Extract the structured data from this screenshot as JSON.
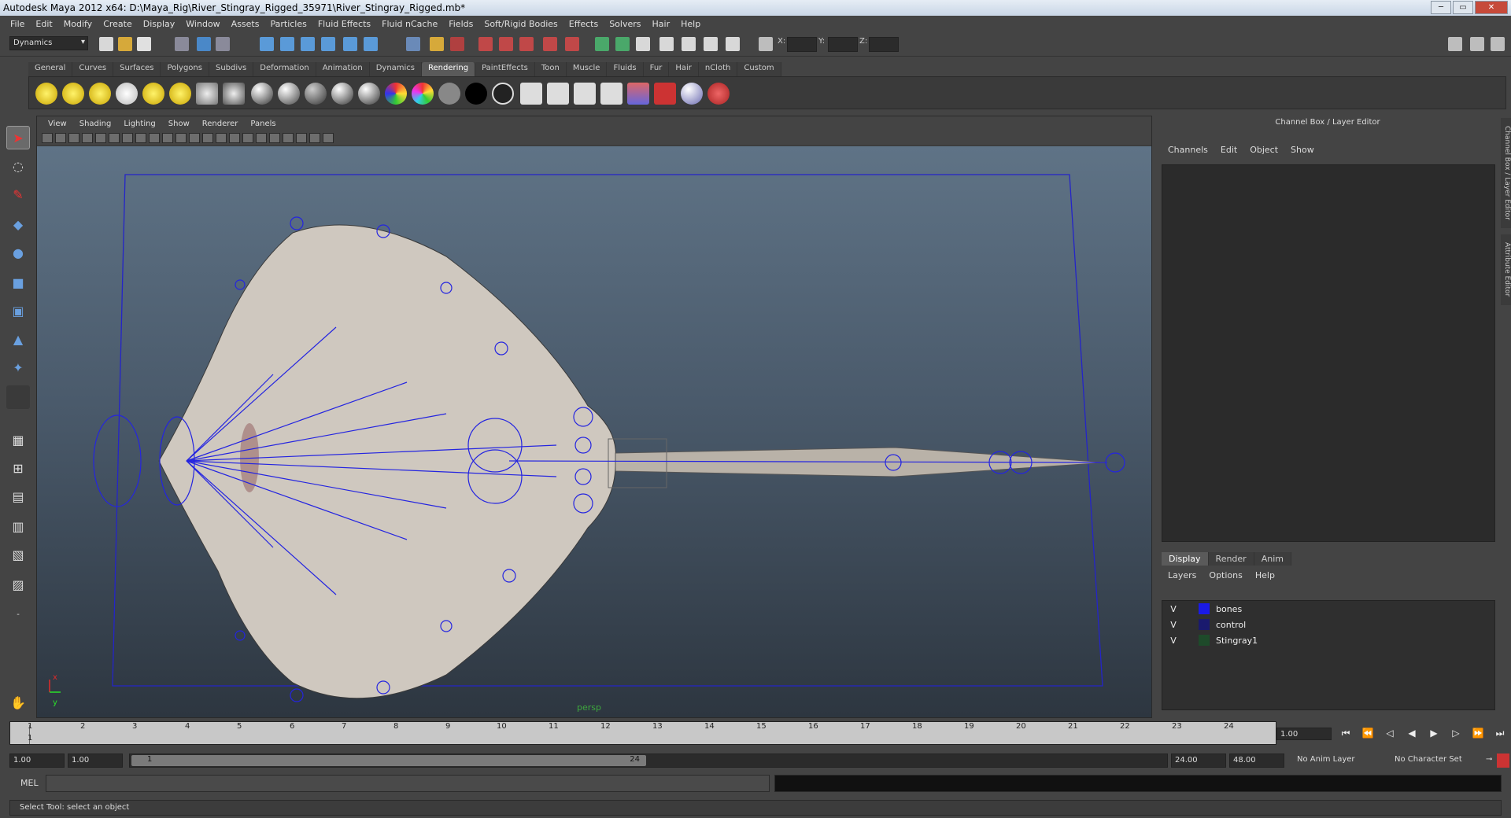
{
  "window": {
    "title": "Autodesk Maya 2012 x64: D:\\Maya_Rig\\River_Stingray_Rigged_35971\\River_Stingray_Rigged.mb*"
  },
  "menubar": [
    "File",
    "Edit",
    "Modify",
    "Create",
    "Display",
    "Window",
    "Assets",
    "Particles",
    "Fluid Effects",
    "Fluid nCache",
    "Fields",
    "Soft/Rigid Bodies",
    "Effects",
    "Solvers",
    "Hair",
    "Help"
  ],
  "status_line": {
    "mode": "Dynamics",
    "x_label": "X:",
    "y_label": "Y:",
    "z_label": "Z:"
  },
  "shelf_tabs": [
    "General",
    "Curves",
    "Surfaces",
    "Polygons",
    "Subdivs",
    "Deformation",
    "Animation",
    "Dynamics",
    "Rendering",
    "PaintEffects",
    "Toon",
    "Muscle",
    "Fluids",
    "Fur",
    "Hair",
    "nCloth",
    "Custom"
  ],
  "shelf_active": "Rendering",
  "viewport": {
    "menu": [
      "View",
      "Shading",
      "Lighting",
      "Show",
      "Renderer",
      "Panels"
    ],
    "camera_label": "persp",
    "axis_x": "x",
    "axis_y": "y"
  },
  "channel_box": {
    "title": "Channel Box / Layer Editor",
    "menu": [
      "Channels",
      "Edit",
      "Object",
      "Show"
    ]
  },
  "layer_editor": {
    "tabs": [
      "Display",
      "Render",
      "Anim"
    ],
    "menu": [
      "Layers",
      "Options",
      "Help"
    ],
    "layers": [
      {
        "visible": "V",
        "name": "bones",
        "color": "#1a1ae6"
      },
      {
        "visible": "V",
        "name": "control",
        "color": "#1a1a6e"
      },
      {
        "visible": "V",
        "name": "Stingray1",
        "color": "#1e4a2a"
      }
    ]
  },
  "side_tabs": [
    "Channel Box / Layer Editor",
    "Attribute Editor"
  ],
  "timeline": {
    "ticks": [
      "1",
      "2",
      "3",
      "4",
      "5",
      "6",
      "7",
      "8",
      "9",
      "10",
      "11",
      "12",
      "13",
      "14",
      "15",
      "16",
      "17",
      "18",
      "19",
      "20",
      "21",
      "22",
      "23",
      "24"
    ],
    "current_marker": "1",
    "current_frame": "1.00"
  },
  "range": {
    "start": "1.00",
    "playback_start": "1.00",
    "slider_start": "1",
    "slider_end": "24",
    "playback_end": "24.00",
    "end": "48.00",
    "anim_layer": "No Anim Layer",
    "character_set": "No Character Set"
  },
  "command_line": {
    "label": "MEL"
  },
  "help_line": "Select Tool: select an object"
}
